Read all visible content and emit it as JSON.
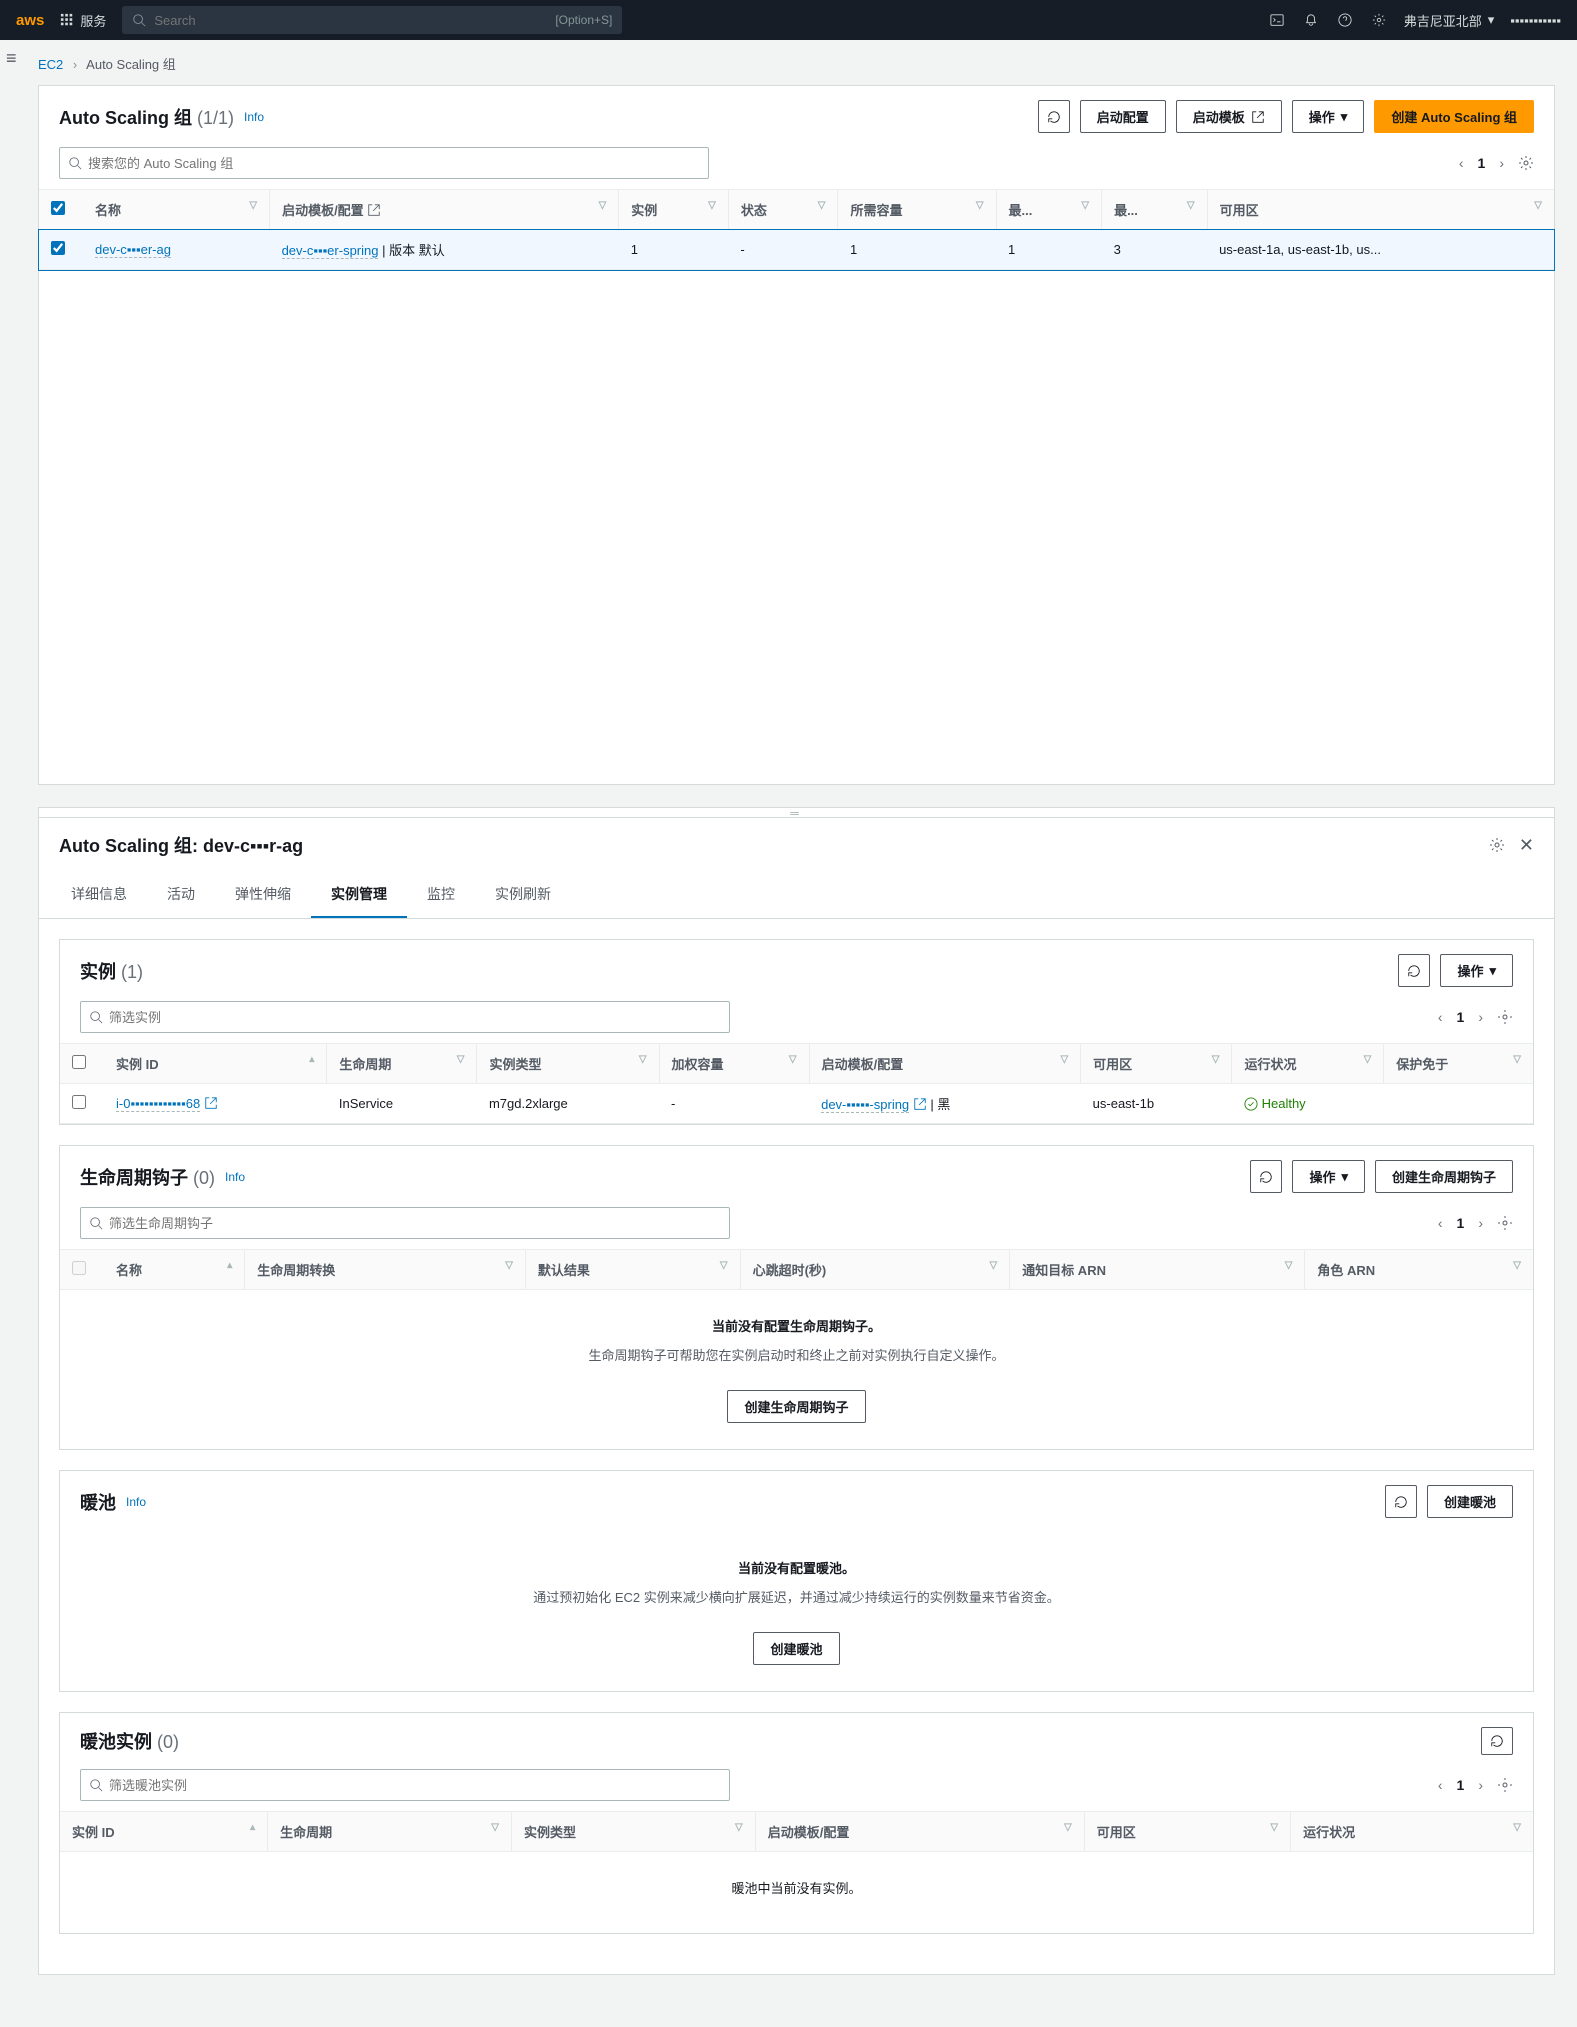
{
  "topnav": {
    "services": "服务",
    "search_placeholder": "Search",
    "shortcut": "[Option+S]",
    "region": "弗吉尼亚北部",
    "account": "▪▪▪▪▪▪▪▪▪▪▪"
  },
  "breadcrumb": {
    "ec2": "EC2",
    "current": "Auto Scaling 组"
  },
  "asg_panel": {
    "title": "Auto Scaling 组",
    "count": "(1/1)",
    "info": "Info",
    "btn_refresh": "⟳",
    "btn_launch_config": "启动配置",
    "btn_launch_template": "启动模板",
    "btn_actions": "操作",
    "btn_create": "创建 Auto Scaling 组",
    "filter_placeholder": "搜索您的 Auto Scaling 组",
    "page": "1",
    "columns": {
      "name": "名称",
      "lt": "启动模板/配置",
      "inst": "实例",
      "status": "状态",
      "desired": "所需容量",
      "min": "最...",
      "max": "最...",
      "az": "可用区"
    },
    "row": {
      "name": "dev-c▪▪▪er-ag",
      "lt": "dev-c▪▪▪er-spring",
      "lt_suffix": " | 版本 默认",
      "instances": "1",
      "status": "-",
      "desired": "1",
      "min": "1",
      "max": "3",
      "az": "us-east-1a, us-east-1b, us..."
    }
  },
  "detail": {
    "title_prefix": "Auto Scaling 组: ",
    "title_name": "dev-c▪▪▪r-ag",
    "tabs": {
      "details": "详细信息",
      "activity": "活动",
      "elastic": "弹性伸缩",
      "instmgmt": "实例管理",
      "monitor": "监控",
      "refresh": "实例刷新"
    }
  },
  "instances": {
    "title": "实例",
    "count": "(1)",
    "btn_actions": "操作",
    "filter_placeholder": "筛选实例",
    "page": "1",
    "columns": {
      "id": "实例 ID",
      "lifecycle": "生命周期",
      "type": "实例类型",
      "weight": "加权容量",
      "lt": "启动模板/配置",
      "az": "可用区",
      "health": "运行状况",
      "protect": "保护免于"
    },
    "row": {
      "id": "i-0▪▪▪▪▪▪▪▪▪▪▪▪68",
      "lifecycle": "InService",
      "type": "m7gd.2xlarge",
      "weight": "-",
      "lt": "dev-▪▪▪▪▪-spring",
      "lt_suffix": " | 黑",
      "az": "us-east-1b",
      "health": "Healthy"
    }
  },
  "hooks": {
    "title": "生命周期钩子",
    "count": "(0)",
    "info": "Info",
    "btn_actions": "操作",
    "btn_create": "创建生命周期钩子",
    "filter_placeholder": "筛选生命周期钩子",
    "page": "1",
    "columns": {
      "name": "名称",
      "transition": "生命周期转换",
      "result": "默认结果",
      "heartbeat": "心跳超时(秒)",
      "target": "通知目标 ARN",
      "role": "角色 ARN"
    },
    "empty1": "当前没有配置生命周期钩子。",
    "empty2": "生命周期钩子可帮助您在实例启动时和终止之前对实例执行自定义操作。",
    "empty_btn": "创建生命周期钩子"
  },
  "warmpool": {
    "title": "暖池",
    "info": "Info",
    "btn_create": "创建暖池",
    "empty1": "当前没有配置暖池。",
    "empty2": "通过预初始化 EC2 实例来减少横向扩展延迟，并通过减少持续运行的实例数量来节省资金。",
    "empty_btn": "创建暖池"
  },
  "warminst": {
    "title": "暖池实例",
    "count": "(0)",
    "filter_placeholder": "筛选暖池实例",
    "page": "1",
    "columns": {
      "id": "实例 ID",
      "lifecycle": "生命周期",
      "type": "实例类型",
      "lt": "启动模板/配置",
      "az": "可用区",
      "health": "运行状况"
    },
    "empty": "暖池中当前没有实例。"
  }
}
